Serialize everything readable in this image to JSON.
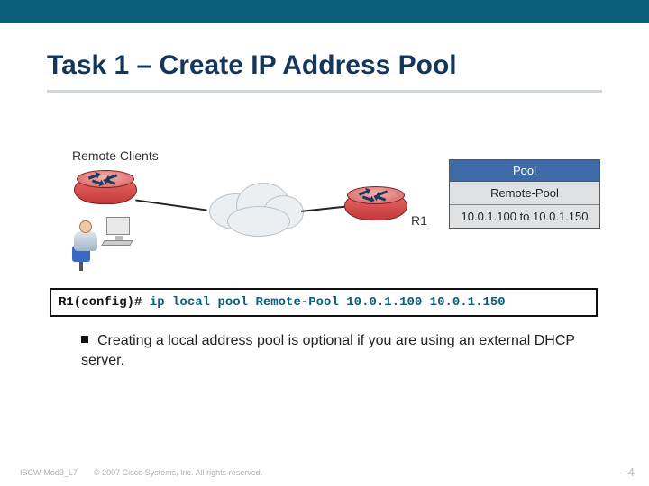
{
  "title": "Task 1 – Create IP Address Pool",
  "diagram": {
    "remote_clients_label": "Remote Clients",
    "r1_label": "R1",
    "pool": {
      "header": "Pool",
      "name": "Remote-Pool",
      "range": "10.0.1.100 to 10.0.1.150"
    }
  },
  "cli": {
    "prompt": "R1(config)#",
    "command": "ip local pool Remote-Pool 10.0.1.100 10.0.1.150"
  },
  "bullets": [
    "Creating a local address pool is optional if you are using an external DHCP server."
  ],
  "footer": {
    "course_code": "ISCW-Mod3_L7",
    "copyright": "© 2007 Cisco Systems, Inc. All rights reserved.",
    "page": "-4"
  }
}
